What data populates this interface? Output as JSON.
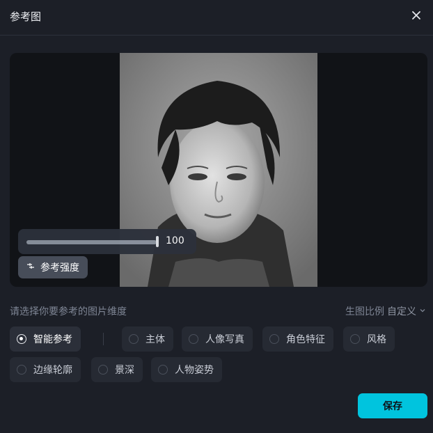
{
  "dialog": {
    "title": "参考图"
  },
  "slider": {
    "value": "100",
    "fraction": 1.0
  },
  "strength_button": {
    "label": "参考强度"
  },
  "hint": "请选择你要参考的图片维度",
  "ratio": {
    "label": "生图比例",
    "value": "自定义"
  },
  "options": [
    {
      "label": "智能参考",
      "selected": true
    },
    {
      "label": "主体",
      "selected": false
    },
    {
      "label": "人像写真",
      "selected": false
    },
    {
      "label": "角色特征",
      "selected": false
    },
    {
      "label": "风格",
      "selected": false
    },
    {
      "label": "边缘轮廓",
      "selected": false
    },
    {
      "label": "景深",
      "selected": false
    },
    {
      "label": "人物姿势",
      "selected": false
    }
  ],
  "save_label": "保存",
  "colors": {
    "accent": "#00c4de",
    "background": "#1c1f27"
  }
}
